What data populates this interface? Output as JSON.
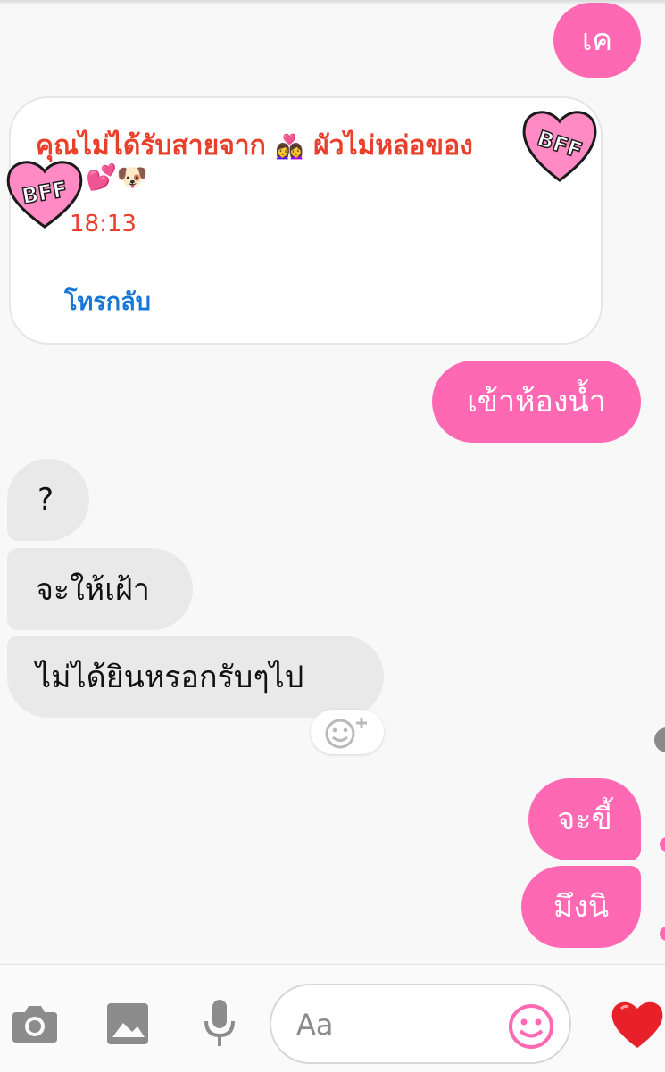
{
  "messages": {
    "m1": "เค",
    "call": {
      "text": "คุณไม่ได้รับสายจาก",
      "name": "ผัวไม่หล่อของ",
      "time": "18:13",
      "action": "โทรกลับ",
      "sticker_label": "BFF"
    },
    "m2": "เข้าห้องน้ำ",
    "m3": "?",
    "m4": "จะให้เฝ้า",
    "m5": "ไม่ได้ยินหรอกรับๆไป",
    "m6": "จะขี้",
    "m7": "มึงนิ"
  },
  "composer": {
    "placeholder": "Aa",
    "icons": [
      "camera-icon",
      "image-icon",
      "microphone-icon",
      "emoji-icon",
      "heart-icon"
    ]
  },
  "colors": {
    "outgoing_bubble": "#ff69b4",
    "incoming_bubble": "#e9e9e9",
    "missed_call_text": "#e8402b",
    "call_back_link": "#1877d6",
    "like_heart": "#e8202a"
  }
}
